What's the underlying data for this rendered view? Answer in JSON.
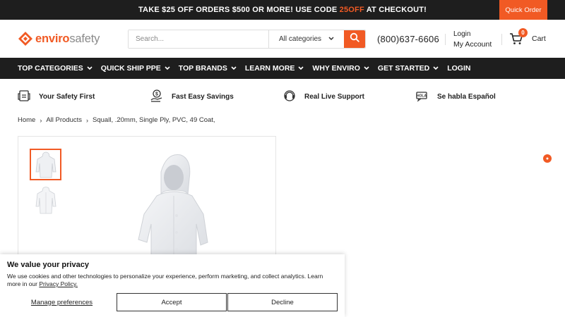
{
  "promo": {
    "text_before": "TAKE $25 OFF ORDERS $500 OR MORE! USE CODE ",
    "code": "25OFF",
    "text_after": " AT CHECKOUT!",
    "quick_order": "Quick Order"
  },
  "header": {
    "logo_part1": "enviro",
    "logo_part2": "safety",
    "search_placeholder": "Search...",
    "category_label": "All categories",
    "phone": "(800)637-6606",
    "login_label": "Login",
    "account_label": "My Account",
    "cart_count": "0",
    "cart_label": "Cart"
  },
  "nav": {
    "items": [
      {
        "label": "TOP CATEGORIES"
      },
      {
        "label": "QUICK SHIP PPE"
      },
      {
        "label": "TOP BRANDS"
      },
      {
        "label": "LEARN MORE"
      },
      {
        "label": "WHY ENVIRO"
      },
      {
        "label": "GET STARTED"
      },
      {
        "label": "LOGIN"
      }
    ]
  },
  "features": [
    {
      "label": "Your Safety First",
      "icon": "safety-icon"
    },
    {
      "label": "Fast Easy Savings",
      "icon": "savings-icon"
    },
    {
      "label": "Real Live Support",
      "icon": "support-icon"
    },
    {
      "label": "Se habla Español",
      "icon": "spanish-icon"
    }
  ],
  "breadcrumb": {
    "home": "Home",
    "all_products": "All Products",
    "current": "Squall, .20mm, Single Ply, PVC, 49 Coat,"
  },
  "cookie": {
    "title": "We value your privacy",
    "text": "We use cookies and other technologies to personalize your experience, perform marketing, and collect analytics. Learn more in our ",
    "policy_link": "Privacy Policy.",
    "manage": "Manage preferences",
    "accept": "Accept",
    "decline": "Decline"
  },
  "colors": {
    "accent": "#f15a24",
    "dark": "#1e1e1e"
  }
}
